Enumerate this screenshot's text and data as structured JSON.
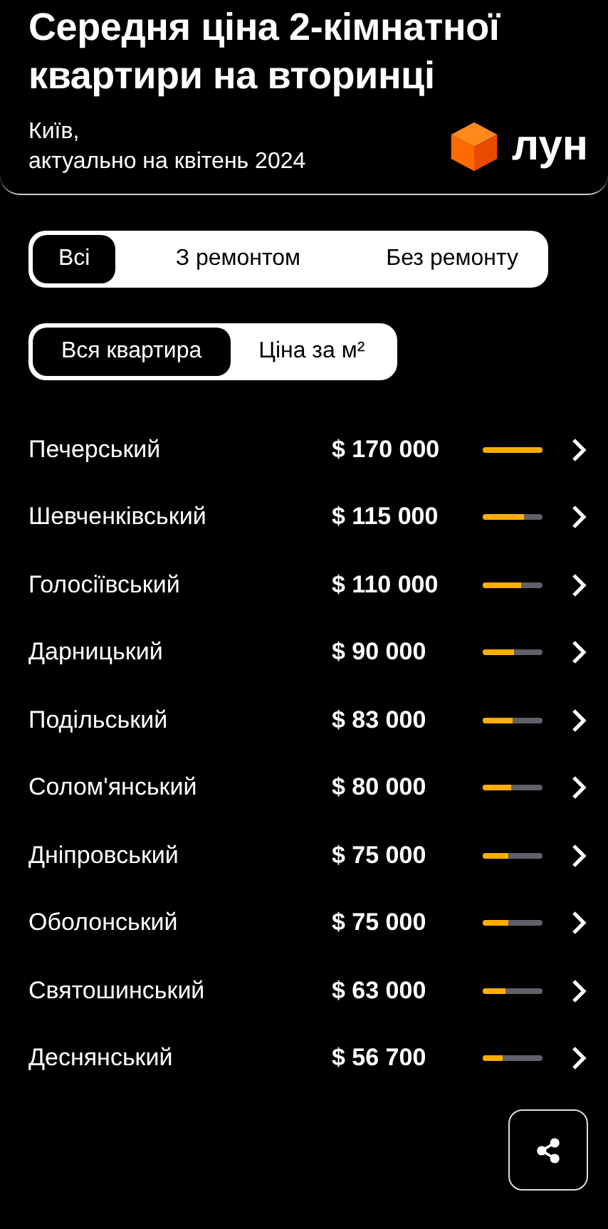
{
  "title": "Середня ціна 2-кімнатної квартири на вторинці",
  "subtitle_city": "Київ,",
  "subtitle_date": "актуально на квітень 2024",
  "logo_text": "лун",
  "repair_tabs": [
    {
      "label": "Всі",
      "selected": true
    },
    {
      "label": "З ремонтом",
      "selected": false
    },
    {
      "label": "Без ремонту",
      "selected": false
    }
  ],
  "price_tabs": [
    {
      "label": "Вся квартира",
      "selected": true
    },
    {
      "label": "Ціна за м²",
      "selected": false
    }
  ],
  "districts": [
    {
      "name": "Печерський",
      "price": "$ 170 000",
      "level": 1
    },
    {
      "name": "Шевченківський",
      "price": "$ 115 000",
      "level": 0.68
    },
    {
      "name": "Голосіївський",
      "price": "$ 110 000",
      "level": 0.65
    },
    {
      "name": "Дарницький",
      "price": "$ 90 000",
      "level": 0.53
    },
    {
      "name": "Подільський",
      "price": "$ 83 000",
      "level": 0.49
    },
    {
      "name": "Солом'янський",
      "price": "$ 80 000",
      "level": 0.47
    },
    {
      "name": "Дніпровський",
      "price": "$ 75 000",
      "level": 0.44
    },
    {
      "name": "Оболонський",
      "price": "$ 75 000",
      "level": 0.44
    },
    {
      "name": "Святошинський",
      "price": "$ 63 000",
      "level": 0.37
    },
    {
      "name": "Деснянський",
      "price": "$ 56 700",
      "level": 0.33
    }
  ]
}
